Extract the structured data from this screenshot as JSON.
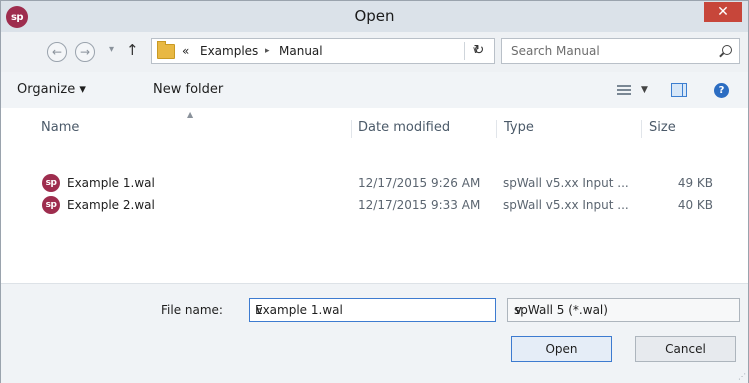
{
  "window": {
    "title": "Open",
    "app_icon_text": "sp",
    "close_glyph": "✕"
  },
  "nav": {
    "back_glyph": "←",
    "forward_glyph": "→",
    "history_glyph": "▾",
    "up_glyph": "↑",
    "breadcrumb": {
      "overflow": "«",
      "items": [
        "Examples",
        "Manual"
      ],
      "separator": "▸"
    },
    "address_dropdown_glyph": "∨",
    "refresh_glyph": "↻",
    "search_placeholder": "Search Manual"
  },
  "toolbar": {
    "organize_label": "Organize ▾",
    "new_folder_label": "New folder",
    "view_dropdown_glyph": "▼",
    "help_glyph": "?"
  },
  "columns": {
    "name": "Name",
    "date_modified": "Date modified",
    "type": "Type",
    "size": "Size",
    "sort_glyph": "▲"
  },
  "files": [
    {
      "icon_text": "sp",
      "name": "Example 1.wal",
      "date_modified": "12/17/2015 9:26 AM",
      "type": "spWall v5.xx Input ...",
      "size": "49 KB"
    },
    {
      "icon_text": "sp",
      "name": "Example 2.wal",
      "date_modified": "12/17/2015 9:33 AM",
      "type": "spWall v5.xx Input ...",
      "size": "40 KB"
    }
  ],
  "footer": {
    "file_name_label": "File name:",
    "file_name_value": "Example 1.wal",
    "file_name_dropdown_glyph": "∨",
    "file_type_value": "spWall 5 (*.wal)",
    "file_type_dropdown_glyph": "∨",
    "open_label": "Open",
    "cancel_label": "Cancel",
    "resize_grip_glyph": "⋰"
  },
  "colors": {
    "titlebar": "#dbe2e9",
    "accent": "#3d7bd0",
    "close": "#c7463a",
    "app_icon": "#9e2d4e"
  }
}
